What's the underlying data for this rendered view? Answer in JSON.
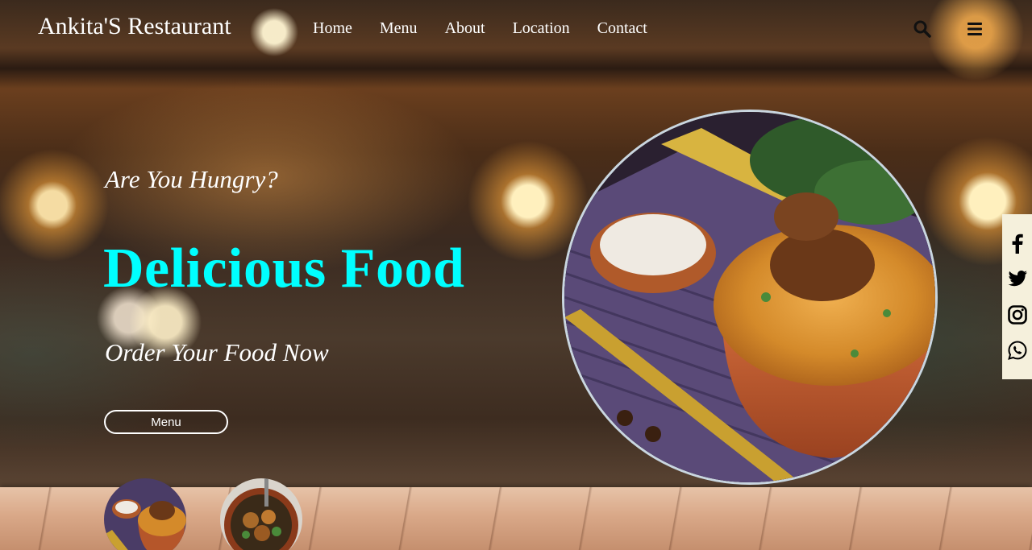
{
  "header": {
    "brand": "Ankita'S Restaurant",
    "nav": [
      "Home",
      "Menu",
      "About",
      "Location",
      "Contact"
    ],
    "icons": [
      "search-icon",
      "hamburger-menu-icon"
    ]
  },
  "hero": {
    "kicker": "Are You Hungry?",
    "title": "Delicious Food",
    "subtitle": "Order Your Food Now",
    "button_label": "Menu"
  },
  "social": {
    "icons": [
      "facebook-icon",
      "twitter-icon",
      "instagram-icon",
      "whatsapp-icon"
    ]
  },
  "colors": {
    "accent": "#00ffff",
    "text": "#ffffff",
    "social_bg": "#f5f0dc"
  }
}
